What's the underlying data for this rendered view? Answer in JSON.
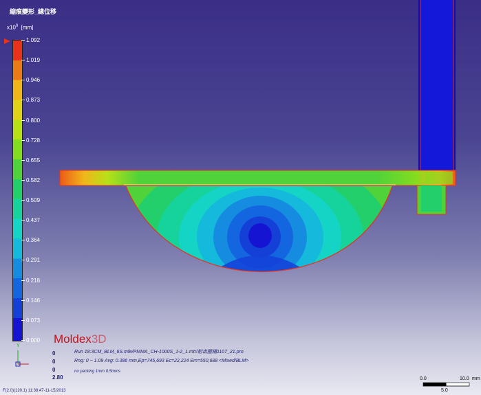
{
  "viewer": {
    "title": "縮痕變形_總位移",
    "unit_multiplier": "x10",
    "unit_exponent": "0",
    "unit": "[mm]"
  },
  "legend": {
    "ticks": [
      "1.092",
      "1.019",
      "0.946",
      "0.873",
      "0.800",
      "0.728",
      "0.655",
      "0.582",
      "0.509",
      "0.437",
      "0.364",
      "0.291",
      "0.218",
      "0.146",
      "0.073",
      "0.000"
    ],
    "colors": [
      "#e8321a",
      "#ec7a16",
      "#f1b51a",
      "#e0d218",
      "#b7e017",
      "#84dc1f",
      "#4fd23a",
      "#22cf6a",
      "#16d39c",
      "#14d4c6",
      "#14b9dc",
      "#168ce0",
      "#1466e0",
      "#1440d8",
      "#1414d2"
    ]
  },
  "branding": {
    "logo_main": "Moldex",
    "logo_suffix": "3D"
  },
  "run_info": {
    "line1": "Run 18:3CM_BLM_6S.mfe/PMMA_CH-1000S_1-2_1.mtr/射出壓縮1107_21.pro",
    "line2": "Rng: 0 ~ 1.09  Avg: 0.386 mm,Ep=745,693 Ec=22,224 Em=550,688 <Mixed/BLM>",
    "line3": "no packing 1mm 0.5mms"
  },
  "coordinates": {
    "x": "0",
    "y": "0",
    "z": "0",
    "zoom": "2.80"
  },
  "axes": {
    "y_label": "Y"
  },
  "scale_bar": {
    "start": "0.0",
    "end": "10.0",
    "unit": "mm",
    "mid": "5.0"
  },
  "timestamp": "F(2.0)(120.1) 11:38:47-11-15/2013"
}
